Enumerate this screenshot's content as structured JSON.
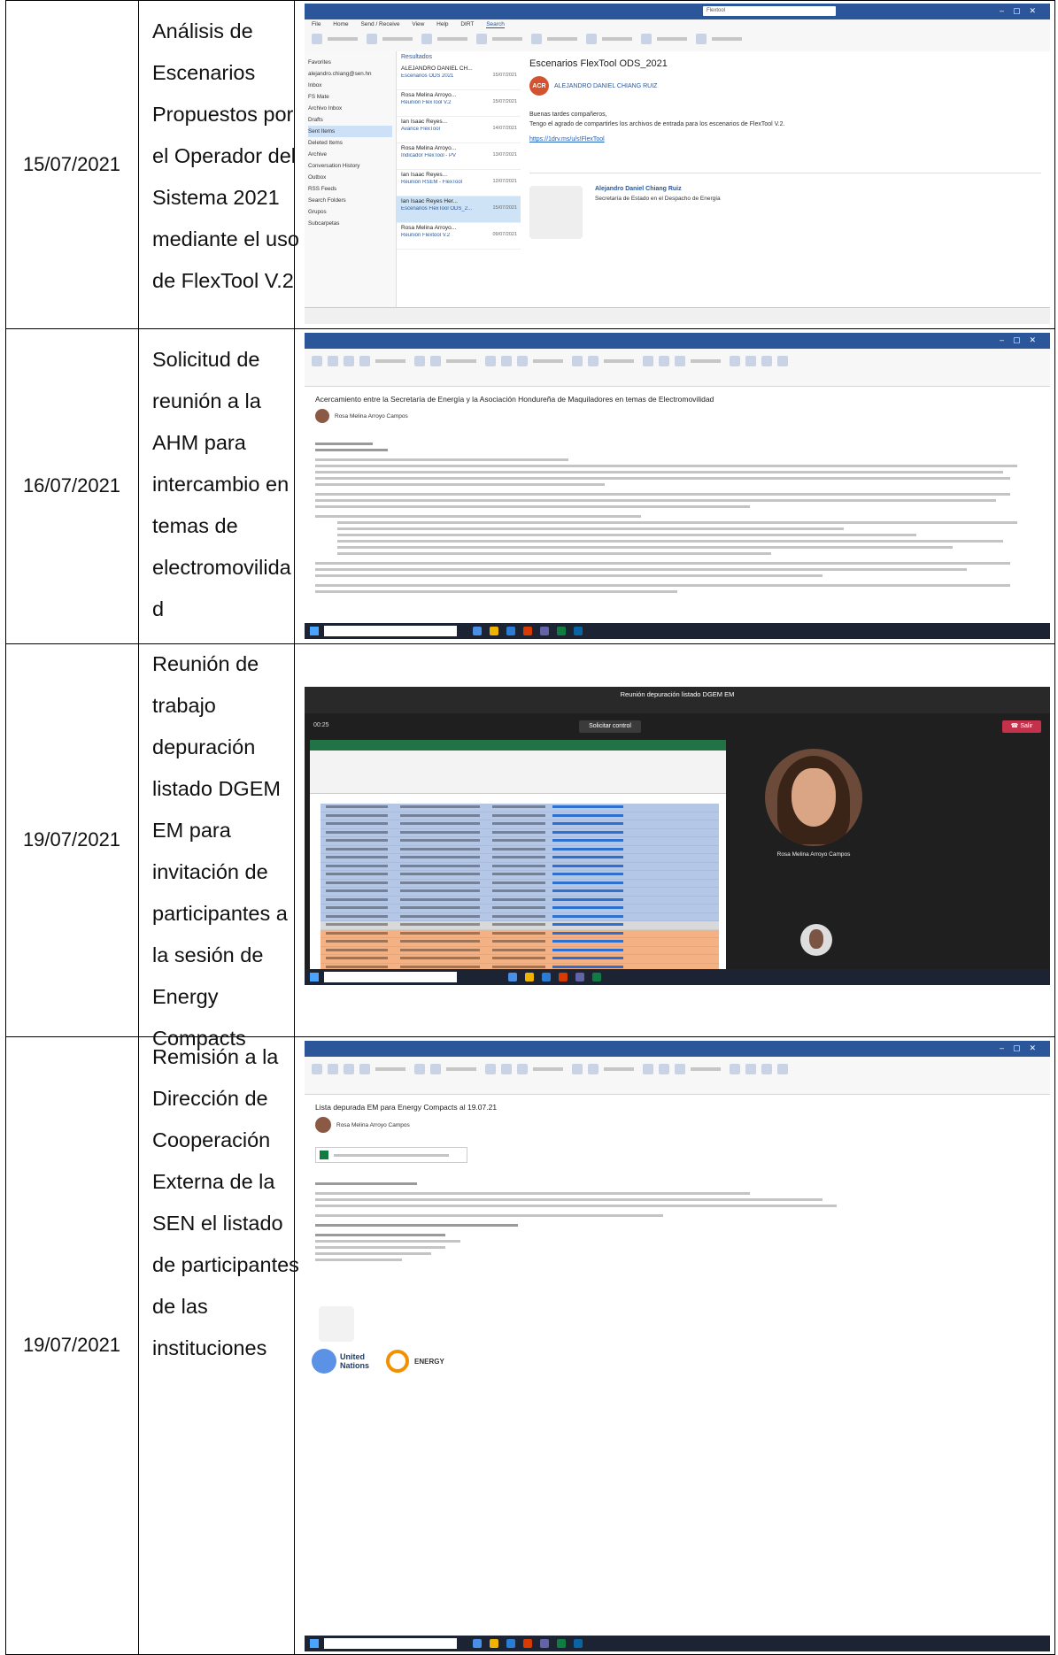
{
  "rows": [
    {
      "date": "15/07/2021",
      "desc_lines": [
        "Análisis de",
        "Escenarios",
        "Propuestos por",
        "el Operador del",
        "Sistema 2021",
        "mediante el uso",
        "de FlexTool V.2"
      ],
      "shot": {
        "type": "outlook-inbox",
        "search": "Flextool",
        "tabs": [
          "File",
          "Home",
          "Send / Receive",
          "View",
          "Help",
          "DIRT",
          "Search"
        ],
        "folders": [
          "Favorites",
          "alejandro.chiang@sen.hn",
          "Inbox",
          "FS Mate",
          "Archivo Inbox",
          "Drafts",
          "Sent Items",
          "Deleted Items",
          "Archive",
          "Conversation History",
          "Outbox",
          "RSS Feeds",
          "Search Folders",
          "Grupos",
          "Subcarpetas"
        ],
        "list_heading": "Resultados",
        "messages": [
          {
            "from": "ALEJANDRO DANIEL CH...",
            "subj": "Escenarios ODS 2021",
            "date": "15/07/2021",
            "sel": false
          },
          {
            "from": "Rosa Melina Arroyo...",
            "subj": "Reunión FlexTool V.2",
            "date": "15/07/2021",
            "sel": false
          },
          {
            "from": "Ian Isaac Reyes...",
            "subj": "Avance FlexTool",
            "date": "14/07/2021",
            "sel": false
          },
          {
            "from": "Rosa Melina Arroyo...",
            "subj": "Indicador FlexTool - PV",
            "date": "13/07/2021",
            "sel": false
          },
          {
            "from": "Ian Isaac Reyes...",
            "subj": "Reunión RSEM - FlexTool",
            "date": "12/07/2021",
            "sel": false
          },
          {
            "from": "Ian Isaac Reyes Her...",
            "subj": "Escenarios FlexTool ODS_2...",
            "date": "15/07/2021",
            "sel": true
          },
          {
            "from": "Rosa Melina Arroyo...",
            "subj": "Reunión Flextool V.2",
            "date": "09/07/2021",
            "sel": false
          }
        ],
        "reading_title": "Escenarios FlexTool ODS_2021",
        "reading_from": "ALEJANDRO DANIEL CHIANG RUIZ",
        "reading_avatar": "ACR",
        "reading_greeting": "Buenas tardes compañeros,",
        "reading_body": "Tengo el agrado de compartirles los archivos de entrada para los escenarios de FlexTool V.2.",
        "reading_link": "https://1drv.ms/u/s!FlexTool",
        "sig_name": "Alejandro Daniel Chiang Ruiz",
        "sig_org": "Secretaría de Estado en el Despacho de Energía"
      }
    },
    {
      "date": "16/07/2021",
      "desc_lines": [
        "Solicitud de",
        "reunión a la",
        "AHM para",
        "intercambio en",
        "temas de",
        "electromovilida",
        "d"
      ],
      "shot": {
        "type": "outlook-message",
        "subject": "Acercamiento entre la Secretaría de Energía y la Asociación Hondureña de Maquiladores en temas de Electromovilidad",
        "from": "Rosa Melina Arroyo Campos"
      }
    },
    {
      "date": "19/07/2021",
      "desc_lines": [
        "Reunión de",
        "trabajo",
        "depuración",
        "listado DGEM",
        "EM para",
        "invitación de",
        "participantes a",
        "la sesión de",
        "Energy",
        "Compacts"
      ],
      "shot": {
        "type": "teams",
        "meeting": "Reunión depuración listado DGEM EM",
        "request": "Solicitar control",
        "leave": "Salir",
        "timer": "00:25",
        "participant": "Rosa Melina Arroyo Campos"
      }
    },
    {
      "date": "19/07/2021",
      "desc_lines": [
        "Remisión a la",
        "Dirección de",
        "Cooperación",
        "Externa de la",
        "SEN el listado",
        "de participantes",
        "de las",
        "instituciones"
      ],
      "shot": {
        "type": "outlook-message",
        "subject": "Lista depurada EM para Energy Compacts al 19.07.21",
        "from": "Rosa Melina Arroyo Campos",
        "logo_un": "United Nations",
        "logo_energy": "ENERGY"
      }
    }
  ],
  "colors": {
    "outlook_blue": "#2b579a",
    "teams_dark": "#1f1f1f",
    "leave_red": "#c4314b",
    "highlight": "#ffe500"
  }
}
